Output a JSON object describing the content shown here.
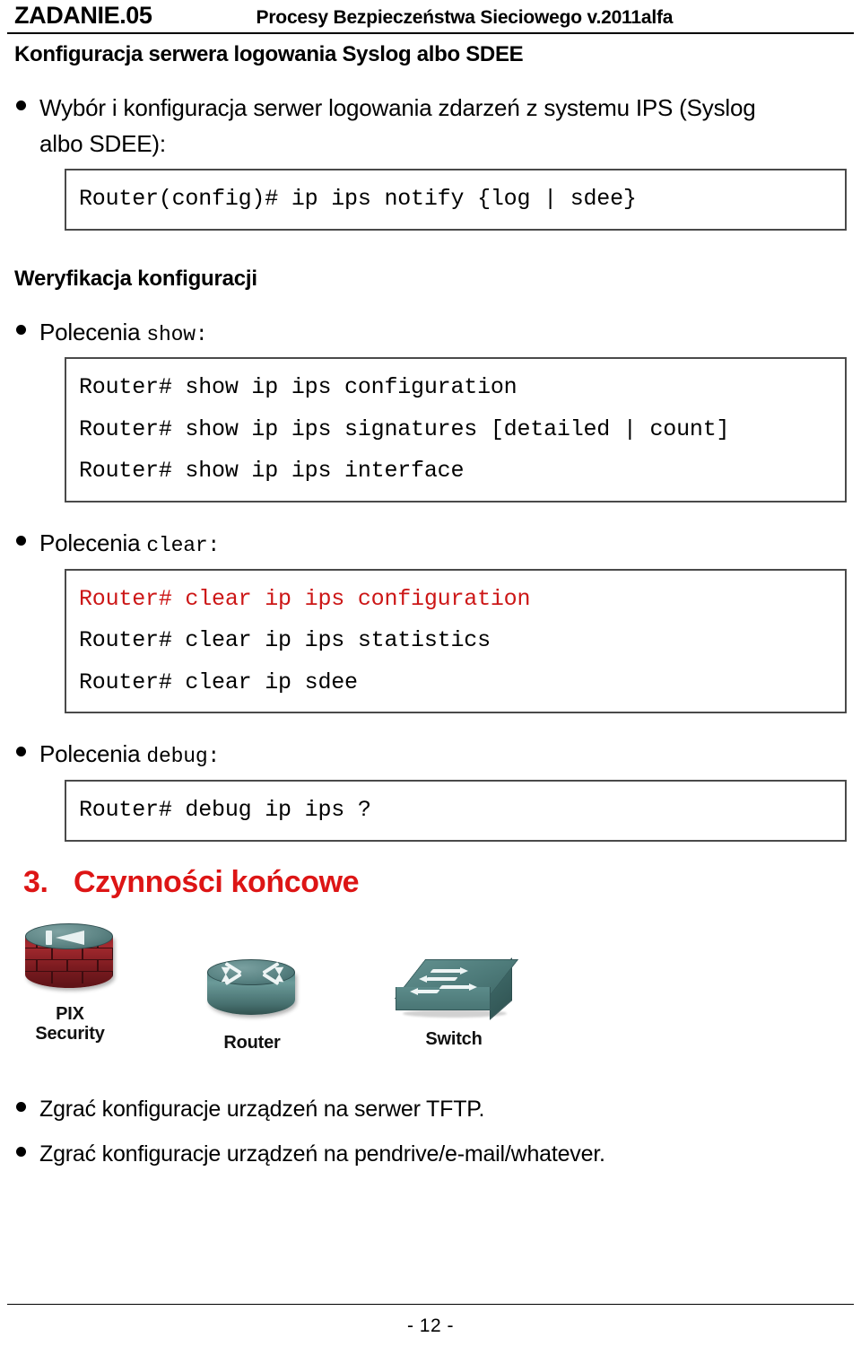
{
  "header": {
    "title": "ZADANIE.05",
    "subtitle": "Procesy Bezpieczeństwa Sieciowego  v.2011alfa"
  },
  "section_heading": "Konfiguracja serwera logowania Syslog albo SDEE",
  "bullets": {
    "intro": "Wybór i konfiguracja serwer logowania zdarzeń z systemu IPS (Syslog albo SDEE):",
    "show_label": "Polecenia ",
    "show_mono": "show:",
    "clear_label": "Polecenia ",
    "clear_mono": "clear:",
    "debug_label": "Polecenia ",
    "debug_mono": "debug:"
  },
  "code_notify": {
    "lines": [
      {
        "text": "Router(config)# ip ips notify {log | sdee}",
        "color": "#000000"
      }
    ]
  },
  "verify_heading": "Weryfikacja konfiguracji",
  "code_show": {
    "lines": [
      {
        "text": "Router# show ip ips configuration",
        "color": "#000000"
      },
      {
        "text": "Router# show ip ips signatures [detailed | count]",
        "color": "#000000"
      },
      {
        "text": "Router# show ip ips interface",
        "color": "#000000"
      }
    ]
  },
  "code_clear": {
    "lines": [
      {
        "text": "Router# clear ip ips configuration",
        "color": "#cc1616"
      },
      {
        "text": "Router# clear ip ips statistics",
        "color": "#000000"
      },
      {
        "text": "Router# clear ip sdee",
        "color": "#000000"
      }
    ]
  },
  "code_debug": {
    "lines": [
      {
        "text": "Router# debug ip ips ?",
        "color": "#000000"
      }
    ]
  },
  "final_section": {
    "number": "3.",
    "title": "Czynności końcowe",
    "color": "#dd1515"
  },
  "devices": [
    {
      "icon": "pix-firewall-icon",
      "caption_line1": "PIX",
      "caption_line2": "Security"
    },
    {
      "icon": "router-icon",
      "caption_line1": "Router",
      "caption_line2": ""
    },
    {
      "icon": "switch-icon",
      "caption_line1": "Switch",
      "caption_line2": ""
    }
  ],
  "final_bullets": [
    "Zgrać konfiguracje urządzeń na serwer TFTP.",
    "Zgrać konfiguracje urządzeń na pendrive/e-mail/whatever."
  ],
  "footer": {
    "page_number": "- 12 -"
  }
}
